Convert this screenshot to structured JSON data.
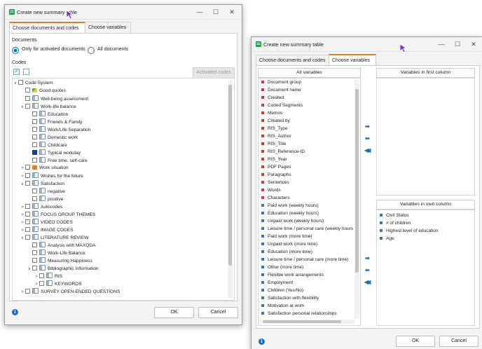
{
  "colors": {
    "accent_tab": "#e8782a",
    "primary_blue": "#1b6ec8",
    "red_sq": "#d63b2a",
    "blue_sq": "#3a71c4",
    "orange_cond": "#e07a2e"
  },
  "left_dialog": {
    "title": "Create new summary table",
    "tabs": [
      {
        "label": "Choose documents and codes"
      },
      {
        "label": "Choose variables"
      }
    ],
    "documents_label": "Documents",
    "radio_only": "Only for activated documents",
    "radio_all": "All documents",
    "codes_label": "Codes",
    "activated_codes_button": "Activated codes",
    "tree": [
      {
        "t": "Code System",
        "w": "v",
        "icon": "none"
      },
      {
        "t": "Good quotes",
        "w": "",
        "icon": "green"
      },
      {
        "t": "Well-being assessment",
        "w": "",
        "icon": "tag"
      },
      {
        "t": "Work-life balance",
        "w": "v",
        "icon": "tag"
      },
      {
        "t": "Education",
        "w": "",
        "icon": "tag"
      },
      {
        "t": "Friends & Family",
        "w": "",
        "icon": "tag"
      },
      {
        "t": "Work/Life Separation",
        "w": "",
        "icon": "tag"
      },
      {
        "t": "Domestic work",
        "w": "",
        "icon": "tag"
      },
      {
        "t": "Childcare",
        "w": "",
        "icon": "tag"
      },
      {
        "t": "Typical workday",
        "w": "",
        "icon": "tag"
      },
      {
        "t": "Free time, self-care",
        "w": "",
        "icon": "tag"
      },
      {
        "t": "Work situation",
        "w": ">",
        "icon": "orange"
      },
      {
        "t": "Wishes for the future",
        "w": ">",
        "icon": "tag"
      },
      {
        "t": "Satisfaction",
        "w": "v",
        "icon": "tag"
      },
      {
        "t": "negative",
        "w": "",
        "icon": "tag"
      },
      {
        "t": "positive",
        "w": "",
        "icon": "tag"
      },
      {
        "t": "Autocodes",
        "w": ">",
        "icon": "tag"
      },
      {
        "t": "FOCUS GROUP THEMES",
        "w": ">",
        "icon": "tag"
      },
      {
        "t": "VIDEO CODES",
        "w": ">",
        "icon": "tag"
      },
      {
        "t": "IMAGE CODES",
        "w": ">",
        "icon": "tag"
      },
      {
        "t": "LITERATURE REVIEW",
        "w": "v",
        "icon": "tag"
      },
      {
        "t": "Analysis with MAXQDA",
        "w": "",
        "icon": "tag"
      },
      {
        "t": "Work-Life Balance",
        "w": "",
        "icon": "tag"
      },
      {
        "t": "Measuring Happiness",
        "w": "",
        "icon": "tag"
      },
      {
        "t": "Bibliographic Information",
        "w": "v",
        "icon": "tag"
      },
      {
        "t": "RIS",
        "w": ">",
        "icon": "tag"
      },
      {
        "t": "KEYWORDS",
        "w": ">",
        "icon": "tag"
      },
      {
        "t": "SURVEY OPEN-ENDED QUESTIONS",
        "w": ">",
        "icon": "tag"
      }
    ],
    "ok": "OK",
    "cancel": "Cancel"
  },
  "right_dialog": {
    "title": "Create new summary table",
    "tabs": [
      {
        "label": "Choose documents and codes"
      },
      {
        "label": "Choose variables"
      }
    ],
    "all_variables_header": "All variables",
    "first_column_header": "Variables in first column",
    "own_column_header": "Variables in own column",
    "all_variables": [
      {
        "t": "Document group",
        "c": "red"
      },
      {
        "t": "Document name",
        "c": "red"
      },
      {
        "t": "Created",
        "c": "red"
      },
      {
        "t": "Coded Segments",
        "c": "red"
      },
      {
        "t": "Memos",
        "c": "red"
      },
      {
        "t": "Created by",
        "c": "red"
      },
      {
        "t": "RIS_Type",
        "c": "red"
      },
      {
        "t": "RIS_Author",
        "c": "red"
      },
      {
        "t": "RIS_Title",
        "c": "red"
      },
      {
        "t": "RIS_Reference-ID",
        "c": "red"
      },
      {
        "t": "RIS_Year",
        "c": "red"
      },
      {
        "t": "PDF Pages",
        "c": "red"
      },
      {
        "t": "Paragraphs",
        "c": "red"
      },
      {
        "t": "Sentences",
        "c": "red"
      },
      {
        "t": "Words",
        "c": "red"
      },
      {
        "t": "Characters",
        "c": "red"
      },
      {
        "t": "Paid work (weekly hours)",
        "c": "blue"
      },
      {
        "t": "Education (weekly hours)",
        "c": "blue"
      },
      {
        "t": "Unpaid work (weekly hours)",
        "c": "blue"
      },
      {
        "t": "Leisure time / personal care (weekly hours",
        "c": "blue"
      },
      {
        "t": "Paid work (more time)",
        "c": "blue"
      },
      {
        "t": "Unpaid work (more time)",
        "c": "blue"
      },
      {
        "t": "Education (more time)",
        "c": "blue"
      },
      {
        "t": "Leisure time / personal care (more time)",
        "c": "blue"
      },
      {
        "t": "Other (more time)",
        "c": "blue"
      },
      {
        "t": "Flexible work arrangements",
        "c": "blue"
      },
      {
        "t": "Employment",
        "c": "blue"
      },
      {
        "t": "Children  (Yes/No)",
        "c": "blue"
      },
      {
        "t": "Satisfaction with flexibility",
        "c": "blue"
      },
      {
        "t": "Motivation at work",
        "c": "blue"
      },
      {
        "t": "Satisfaction personal relationships",
        "c": "blue"
      }
    ],
    "own_column_variables": [
      {
        "t": "Civil Status"
      },
      {
        "t": "# of children"
      },
      {
        "t": "Highest level of education"
      },
      {
        "t": "Age"
      }
    ],
    "ok": "OK",
    "cancel": "Cancel"
  }
}
